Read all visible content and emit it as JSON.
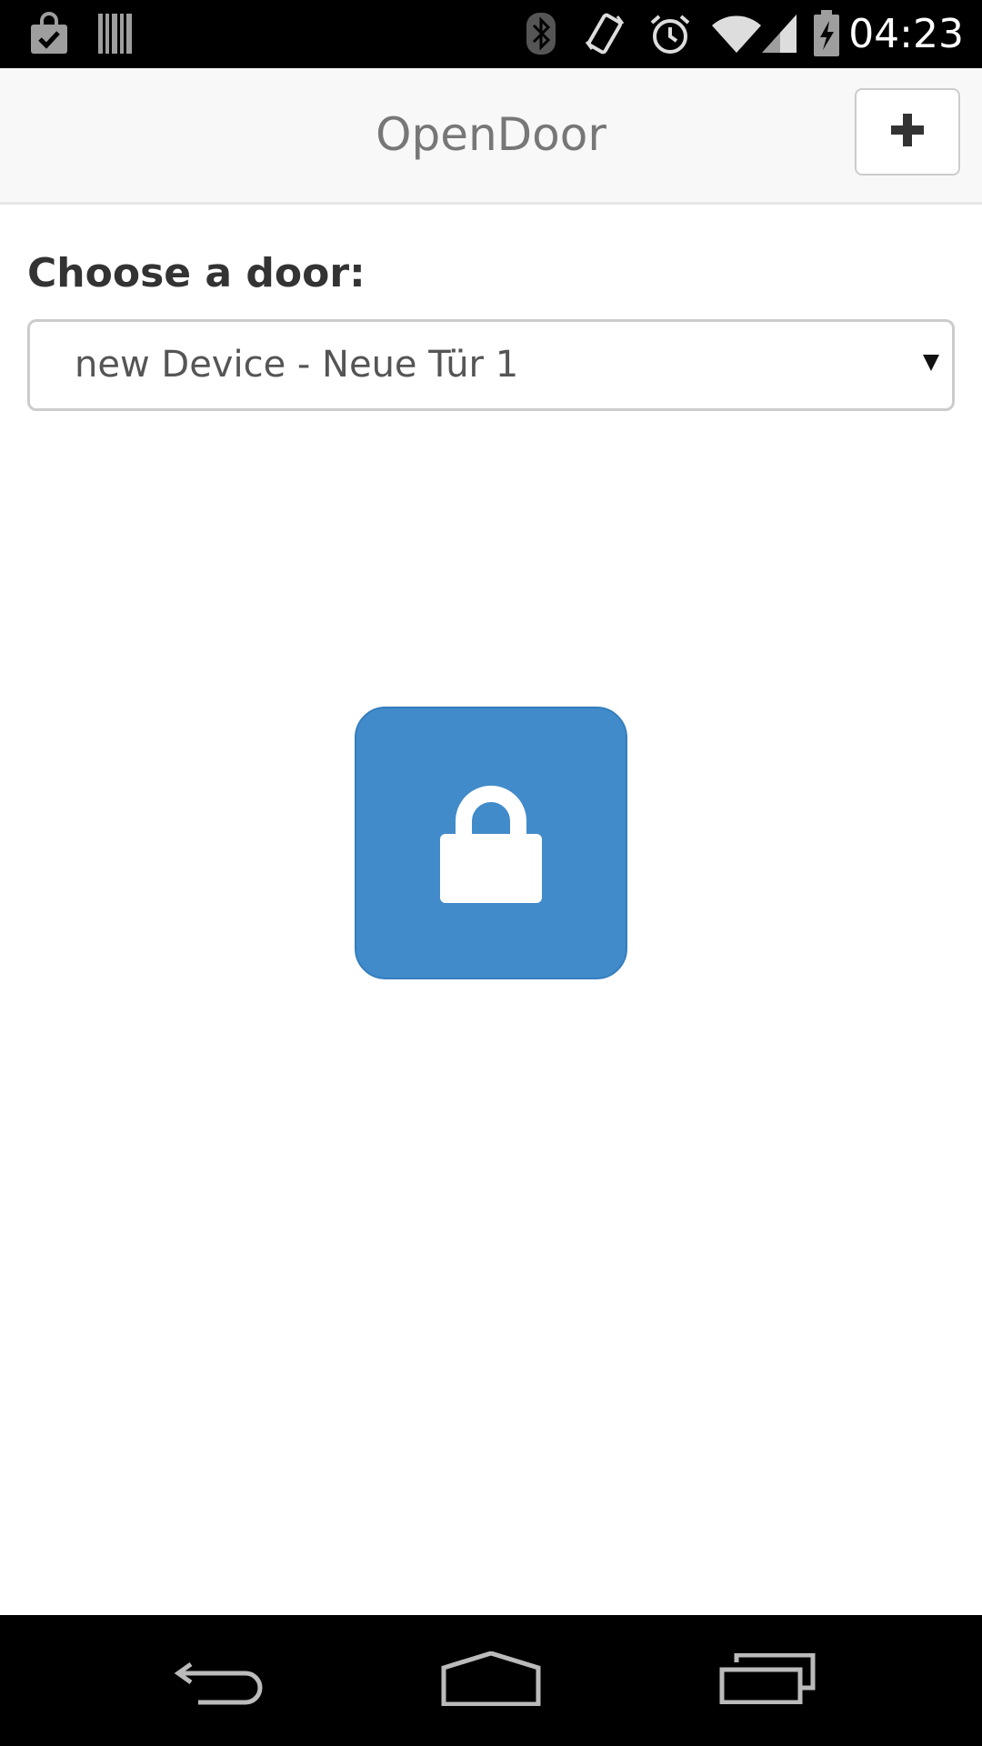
{
  "status_bar": {
    "time": "04:23",
    "icons": [
      "shopping-bag-check-icon",
      "barcode-icon",
      "bluetooth-icon",
      "vibrate-icon",
      "alarm-icon",
      "wifi-icon",
      "cell-signal-icon",
      "battery-charging-icon"
    ]
  },
  "header": {
    "title": "OpenDoor",
    "add_button_icon": "plus-icon"
  },
  "door_chooser": {
    "label": "Choose a door:",
    "selected": "new Device - Neue Tür 1"
  },
  "lock_button": {
    "icon": "lock-icon",
    "color": "#428bca"
  },
  "nav_bar": {
    "icons": [
      "back-icon",
      "home-icon",
      "recent-apps-icon"
    ]
  }
}
